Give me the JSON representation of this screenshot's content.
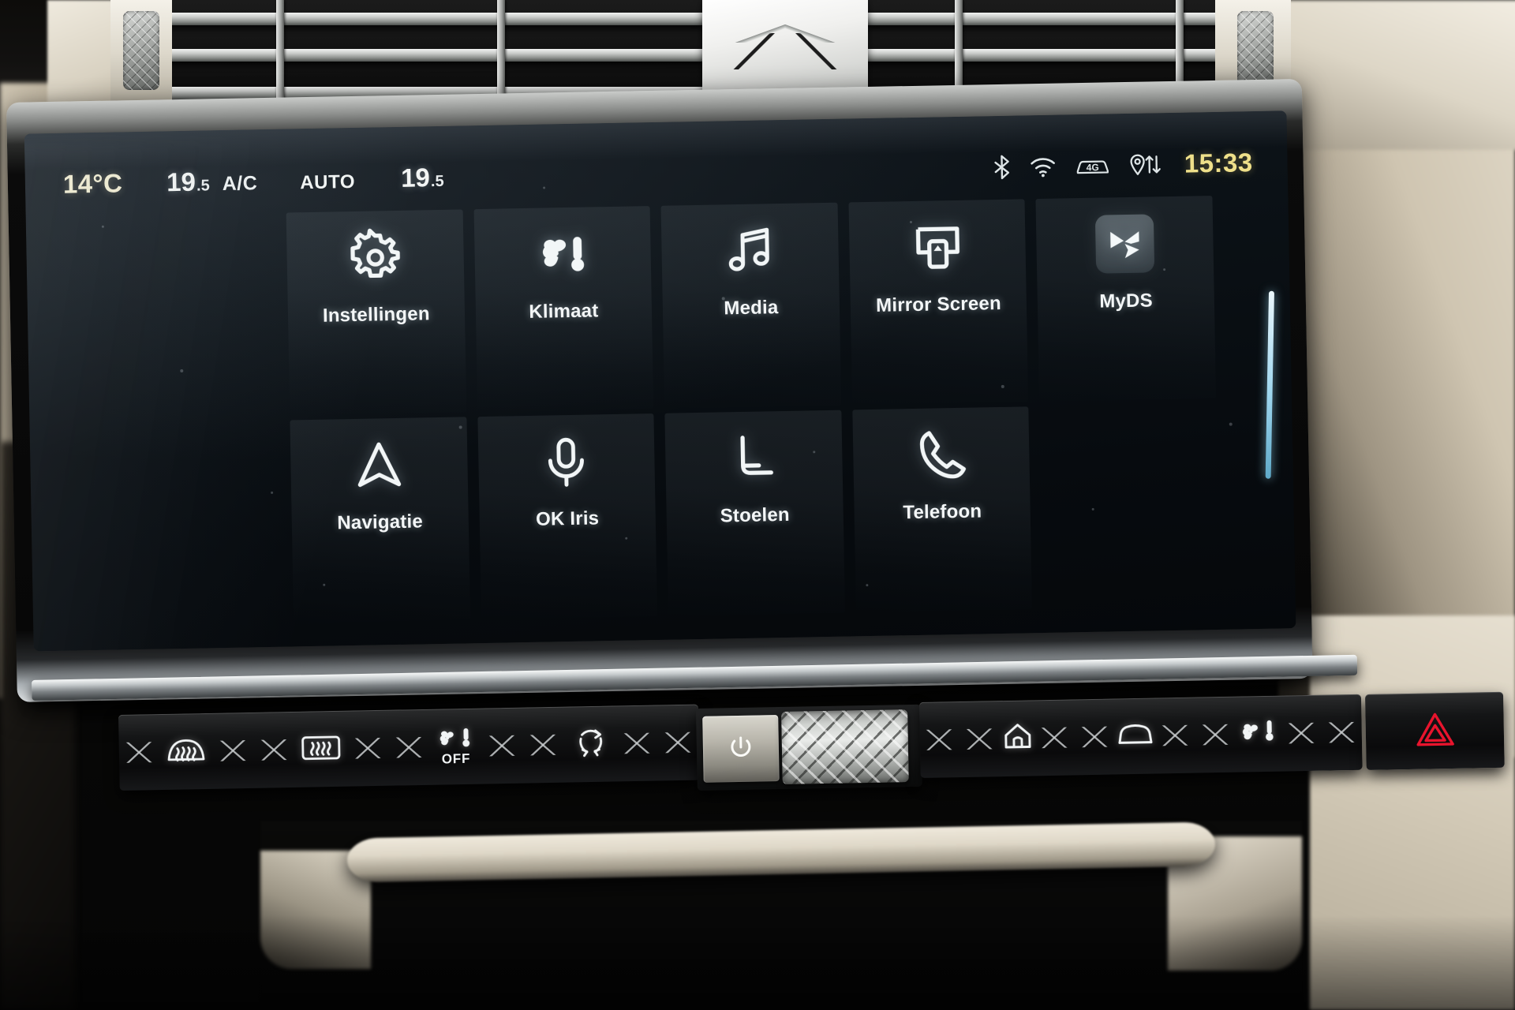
{
  "screen": {
    "status_bar": {
      "outside_temp": "14°C",
      "driver_temp_main": "19",
      "driver_temp_dec": ".5",
      "ac_label": "A/C",
      "auto_label": "AUTO",
      "passenger_temp_main": "19",
      "passenger_temp_dec": ".5",
      "network_label": "4G",
      "time": "15:33",
      "icons": [
        {
          "name": "bluetooth-icon",
          "label": "Bluetooth"
        },
        {
          "name": "wifi-icon",
          "label": "Wi-Fi"
        },
        {
          "name": "connected-car-4g-icon",
          "label": "4G"
        },
        {
          "name": "location-data-transfer-icon",
          "label": "GPS"
        }
      ],
      "temp_color": "#f1ecd2",
      "time_color": "#efe08a"
    },
    "home_grid": {
      "rows": 2,
      "columns": 5,
      "tiles": [
        {
          "id": "instellingen",
          "label": "Instellingen",
          "icon": "gear-icon",
          "active": false
        },
        {
          "id": "klimaat",
          "label": "Klimaat",
          "icon": "fan-thermometer-icon",
          "active": false
        },
        {
          "id": "media",
          "label": "Media",
          "icon": "music-note-icon",
          "active": false
        },
        {
          "id": "mirror-screen",
          "label": "Mirror Screen",
          "icon": "screen-mirroring-icon",
          "active": false
        },
        {
          "id": "myds",
          "label": "MyDS",
          "icon": "ds-logo-icon",
          "active": true
        },
        {
          "id": "navigatie",
          "label": "Navigatie",
          "icon": "navigation-arrow-icon",
          "active": false
        },
        {
          "id": "ok-iris",
          "label": "OK Iris",
          "icon": "microphone-icon",
          "active": false
        },
        {
          "id": "stoelen",
          "label": "Stoelen",
          "icon": "car-seat-icon",
          "active": false
        },
        {
          "id": "telefoon",
          "label": "Telefoon",
          "icon": "phone-handset-icon",
          "active": false
        }
      ],
      "scrollbar": {
        "name": "page-scroll-indicator",
        "color": "#9ed6ee"
      }
    }
  },
  "physical_controls": {
    "left_bar": [
      {
        "id": "front-defrost",
        "icon": "windshield-defrost-icon",
        "label": "Front defrost"
      },
      {
        "id": "rear-defrost",
        "icon": "rear-window-defrost-icon",
        "label": "Rear defrost"
      },
      {
        "id": "climate-off",
        "icon": "climate-off-icon",
        "label": "OFF"
      },
      {
        "id": "recirculation",
        "icon": "air-recirculation-icon",
        "label": "Recirculation"
      }
    ],
    "climate_off_text": "OFF",
    "center": [
      {
        "id": "power",
        "icon": "power-icon",
        "label": "Power"
      },
      {
        "id": "volume-roller",
        "icon": "knurled-roller-icon",
        "label": "Volume"
      }
    ],
    "right_bar": [
      {
        "id": "home",
        "icon": "home-icon",
        "label": "Home"
      },
      {
        "id": "vehicle",
        "icon": "car-icon",
        "label": "Vehicle"
      },
      {
        "id": "climate",
        "icon": "fan-thermometer-icon",
        "label": "Climate"
      }
    ],
    "hazard": {
      "id": "hazard",
      "icon": "hazard-triangle-icon",
      "label": "Hazard lights",
      "color": "#e8142d"
    }
  }
}
